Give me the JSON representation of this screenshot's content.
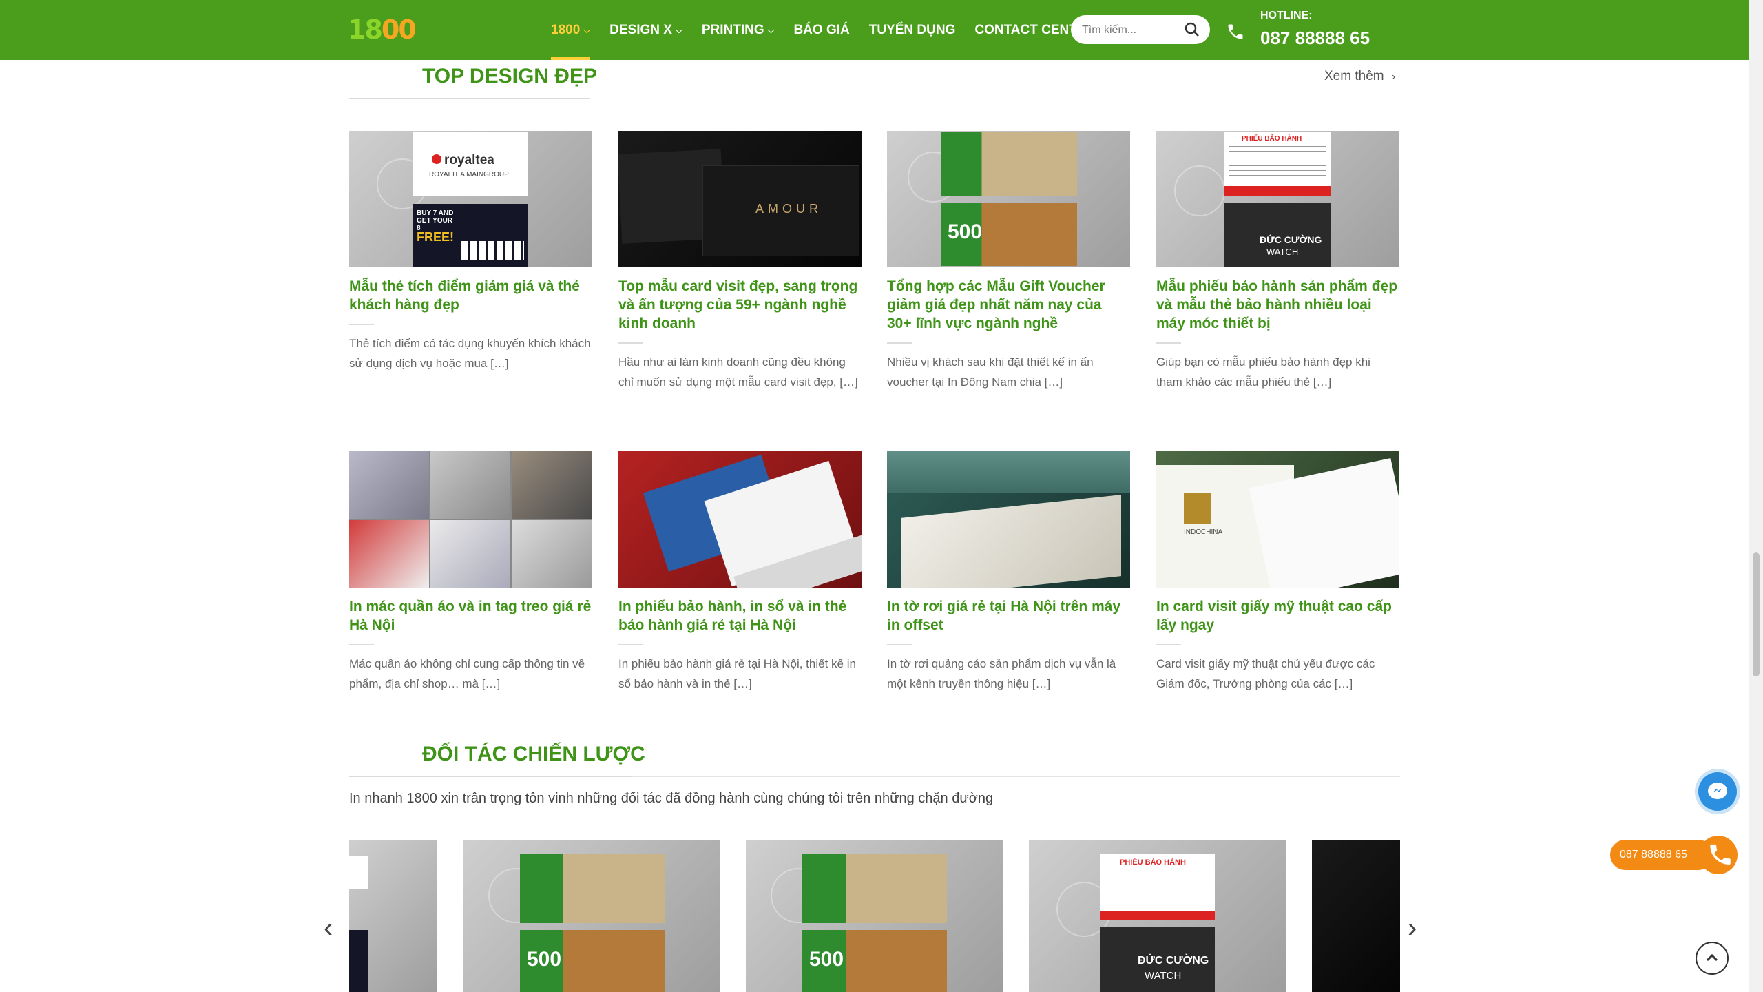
{
  "header": {
    "logo_text": "1800",
    "nav": [
      {
        "label": "1800",
        "has_dropdown": true,
        "active": true
      },
      {
        "label": "DESIGN X",
        "has_dropdown": true
      },
      {
        "label": "PRINTING",
        "has_dropdown": true
      },
      {
        "label": "BÁO GIÁ"
      },
      {
        "label": "TUYỂN DỤNG"
      },
      {
        "label": "CONTACT CENTER"
      }
    ],
    "search_placeholder": "Tìm kiếm...",
    "hotline_label": "HOTLINE:",
    "hotline_number": "087 88888 65"
  },
  "top_design": {
    "title": "TOP DESIGN ĐẸP",
    "see_more": "Xem thêm",
    "cards": [
      {
        "title": "Mẫu thẻ tích điểm giảm giá và thẻ khách hàng đẹp",
        "desc": "Thẻ tích điểm có tác dụng khuyến khích khách sử dụng dịch vụ hoặc mua […]"
      },
      {
        "title": "Top mẫu card visit đẹp, sang trọng và ấn tượng của 59+ ngành nghề kinh doanh",
        "desc": "Hầu như ai làm kinh doanh cũng đều không chỉ muốn sử dụng một mẫu card visit đẹp, […]"
      },
      {
        "title": "Tổng hợp các Mẫu Gift Voucher giảm giá đẹp nhất năm nay của 30+ lĩnh vực ngành nghề",
        "desc": "Nhiều vị khách sau khi đặt thiết kế in ấn voucher tại In Đông Nam chia […]"
      },
      {
        "title": "Mẫu phiếu bảo hành sản phẩm đẹp và mẫu thẻ bảo hành nhiều loại máy móc thiết bị",
        "desc": "Giúp bạn có mẫu phiếu bảo hành đẹp khi tham khảo các mẫu phiếu thẻ […]"
      },
      {
        "title": "In mác quần áo và in tag treo giá rẻ Hà Nội",
        "desc": "Mác quần áo không chỉ cung cấp thông tin về phẩm, địa chỉ shop… mà […]"
      },
      {
        "title": "In phiếu bảo hành, in sổ và in thẻ bảo hành giá rẻ tại Hà Nội",
        "desc": "In phiếu bảo hành giá rẻ tại Hà Nội, thiết kế in sổ bảo hành và in thẻ […]"
      },
      {
        "title": "In tờ rơi giá rẻ tại Hà Nội trên máy in offset",
        "desc": "In tờ rơi quảng cáo sản phẩm dịch vụ vẫn là một kênh truyền thông hiệu […]"
      },
      {
        "title": "In card visit giấy mỹ thuật cao cấp lấy ngay",
        "desc": "Card visit giấy mỹ thuật chủ yếu được các Giám đốc, Trưởng phòng của các […]"
      }
    ],
    "thumb_text": {
      "royaltea": "royaltea",
      "royaltea_sub": "ROYALTEA MAINGROUP",
      "buy7": "BUY 7 AND GET YOUR 8",
      "free": "FREE!",
      "amour": "AMOUR",
      "visa500": "500",
      "warranty_title": "PHIẾU BẢO HÀNH",
      "duc_cuong": "ĐỨC CƯỜNG",
      "watch": "WATCH",
      "indochina": "INDOCHINA"
    }
  },
  "partners": {
    "title": "ĐỐI TÁC CHIẾN LƯỢC",
    "desc": "In nhanh 1800 xin trân trọng tôn vinh những đối tác đã đồng hành cùng chúng tôi trên những chặn đường"
  },
  "floating": {
    "call_label": "087 88888 65"
  },
  "colors": {
    "header_green": "#4a9e1c",
    "title_green": "#3f9418",
    "active_nav": "#ffcf3a",
    "call_orange": "#f28a14",
    "messenger_blue": "#2d8fe0"
  }
}
